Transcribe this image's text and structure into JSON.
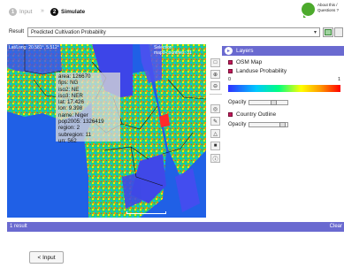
{
  "header": {
    "steps": [
      {
        "num": "1",
        "label": "Input"
      },
      {
        "num": "2",
        "label": "Simulate"
      }
    ],
    "arrow": "»",
    "about_text": "About this / Questions ?"
  },
  "result": {
    "label": "Result",
    "selected": "Predicted Cultivation Probability"
  },
  "map": {
    "coordinates": "Lat/Long: 20.581°, 5.512°",
    "selection_label": "Selection:",
    "selection_value": "map0-countries: 31",
    "info_lines": [
      "area: 126670",
      "fips: NG",
      "iso2: NE",
      "iso3: NER",
      "lat: 17.426",
      "lon: 9.398",
      "name: Niger",
      "pop2005: 1326419",
      "region: 2",
      "subregion: 11",
      "un: 562"
    ]
  },
  "layers": {
    "title": "Layers",
    "items": [
      {
        "name": "OSM Map"
      },
      {
        "name": "Landuse Probability"
      },
      {
        "name": "Country Outline"
      }
    ],
    "legend_min": "0",
    "legend_max": "1",
    "opacity_label": "Opacity",
    "opacity_landuse": 0.6,
    "opacity_outline": 0.8
  },
  "results_bar": {
    "count": "1 result",
    "clear": "Clear"
  },
  "back_button": "< Input",
  "colors": {
    "accent": "#6a6ad0",
    "checkbox": "#c2185b",
    "about_bubble": "#4caa2c"
  }
}
